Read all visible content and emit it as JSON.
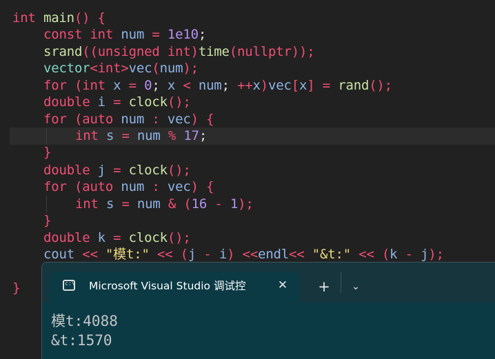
{
  "code": {
    "l1": {
      "t1": "int",
      "t2": " main",
      "t3": "()",
      "t4": " {"
    },
    "l2": {
      "t1": "const",
      "t2": " int",
      "t3": " num",
      "t4": " =",
      "t5": " 1e10",
      "t6": ";"
    },
    "l3": {
      "t1": "srand",
      "t2": "((",
      "t3": "unsigned int",
      "t4": ")",
      "t5": "time",
      "t6": "(",
      "t7": "nullptr",
      "t8": "));"
    },
    "l4": {
      "t1": "vector",
      "t2": "<",
      "t3": "int",
      "t4": ">",
      "t5": "vec",
      "t6": "(",
      "t7": "num",
      "t8": ");"
    },
    "l5": {
      "t1": "for",
      "t2": " (",
      "t3": "int",
      "t4": " x",
      "t5": " =",
      "t6": " 0",
      "t7": ";",
      "t8": " x",
      "t9": " <",
      "t10": " num",
      "t11": ";",
      "t12": " ++",
      "t13": "x",
      "t14": ")",
      "t15": "vec",
      "t16": "[",
      "t17": "x",
      "t18": "]",
      "t19": " =",
      "t20": " rand",
      "t21": "();"
    },
    "l6": {
      "t1": "double",
      "t2": " i",
      "t3": " =",
      "t4": " clock",
      "t5": "();"
    },
    "l7": {
      "t1": "for",
      "t2": " (",
      "t3": "auto",
      "t4": " num",
      "t5": " :",
      "t6": " vec",
      "t7": ")",
      "t8": " {"
    },
    "l8": {
      "t1": "int",
      "t2": " s",
      "t3": " =",
      "t4": " num",
      "t5": " %",
      "t6": " 17",
      "t7": ";"
    },
    "l9": {
      "t1": "}"
    },
    "l10": {
      "t1": "double",
      "t2": " j",
      "t3": " =",
      "t4": " clock",
      "t5": "();"
    },
    "l11": {
      "t1": "for",
      "t2": " (",
      "t3": "auto",
      "t4": " num",
      "t5": " :",
      "t6": " vec",
      "t7": ")",
      "t8": " {"
    },
    "l12": {
      "t1": "int",
      "t2": " s",
      "t3": " =",
      "t4": " num",
      "t5": " &",
      "t6": " (",
      "t7": "16",
      "t8": " -",
      "t9": " 1",
      "t10": ");"
    },
    "l13": {
      "t1": "}"
    },
    "l14": {
      "t1": "double",
      "t2": " k",
      "t3": " =",
      "t4": " clock",
      "t5": "();"
    },
    "l15": {
      "t1": "cout",
      "t2": " <<",
      "t3": " \"模t:\"",
      "t4": " <<",
      "t5": " (",
      "t6": "j",
      "t7": " -",
      "t8": " i",
      "t9": ")",
      "t10": " <<",
      "t11": "endl",
      "t12": "<<",
      "t13": " \"&t:\"",
      "t14": " <<",
      "t15": " (",
      "t16": "k",
      "t17": " -",
      "t18": " j",
      "t19": ");"
    },
    "l16": {
      "t1": "}"
    }
  },
  "terminal": {
    "tab_icon_text": "c:\\",
    "tab_title": "Microsoft Visual Studio 调试控",
    "close_label": "✕",
    "add_label": "+",
    "dropdown_label": "⌄",
    "output": [
      "模t:4088",
      "&t:1570"
    ]
  }
}
